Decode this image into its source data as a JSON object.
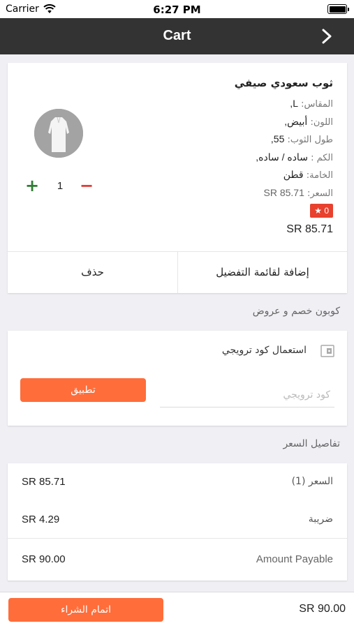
{
  "status_bar": {
    "carrier": "Carrier",
    "time": "6:27 PM"
  },
  "nav": {
    "title": "Cart",
    "back_icon": "chevron-right-icon"
  },
  "cart_item": {
    "name": "ثوب سعودي صيفي",
    "attributes": [
      {
        "label": "المقاس:",
        "value": "L,"
      },
      {
        "label": "اللون:",
        "value": "أبيض,"
      },
      {
        "label": "طول الثوب:",
        "value": "55,"
      },
      {
        "label": "الكم :",
        "value": "ساده / ساده,"
      },
      {
        "label": "الخامة:",
        "value": "قطن"
      },
      {
        "label": "السعر:",
        "value": "SR 85.71"
      }
    ],
    "points_badge": "★ 0",
    "line_total": "SR 85.71",
    "quantity": "1",
    "qty_plus": "+",
    "qty_minus": "−",
    "actions": {
      "delete_label": "حذف",
      "wishlist_label": "إضافة لقائمة التفضيل"
    }
  },
  "coupon": {
    "section_title": "كوبون خصم و عروض",
    "label": "استعمال كود ترويجي",
    "input_placeholder": "كود ترويجي",
    "input_value": "",
    "apply_label": "تطبيق"
  },
  "price_details": {
    "section_title": "تفاصيل السعر",
    "rows": [
      {
        "label": "السعر (1)",
        "amount": "SR 85.71"
      },
      {
        "label": "ضريبة",
        "amount": "SR 4.29"
      },
      {
        "label": "Amount Payable",
        "amount": "SR 90.00"
      }
    ]
  },
  "footer": {
    "checkout_label": "اتمام الشراء",
    "total": "SR 90.00"
  },
  "colors": {
    "nav_bg": "#333333",
    "accent": "#ff6d3a",
    "badge": "#e8412e",
    "plus": "#2e7d32",
    "minus": "#e53935"
  }
}
